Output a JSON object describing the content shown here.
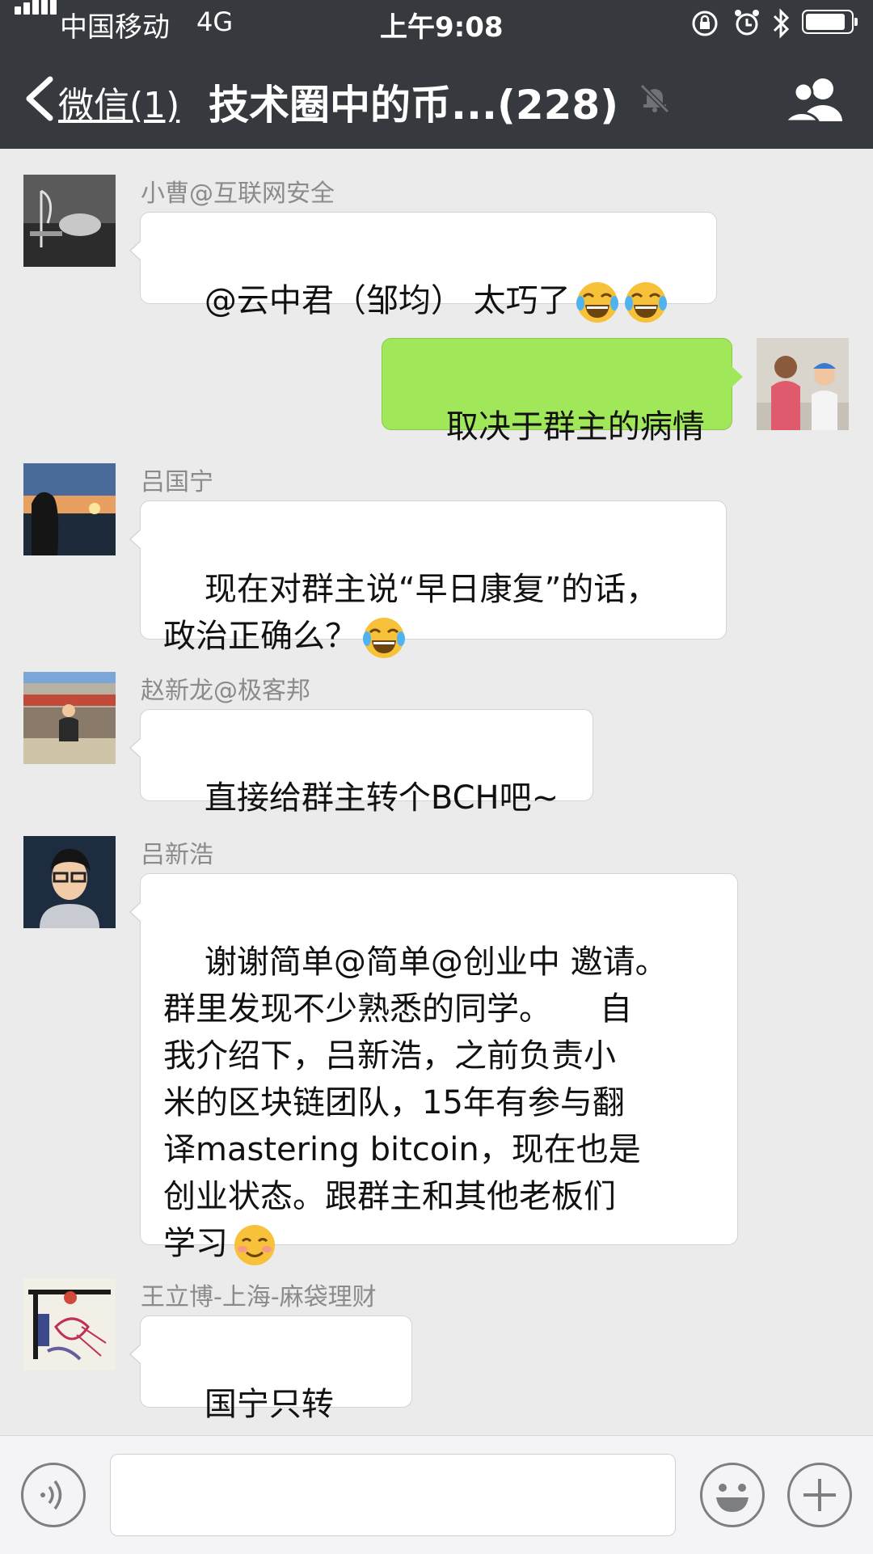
{
  "status_bar": {
    "carrier": "中国移动",
    "network": "4G",
    "time": "上午9:08",
    "icons": [
      "signal-icon",
      "rotation-lock-icon",
      "alarm-icon",
      "bluetooth-icon",
      "battery-icon"
    ]
  },
  "nav": {
    "back_label": "微信(1)",
    "title": "技术圈中的币...(228)",
    "mute_icon": "bell-muted-icon",
    "members_icon": "group-members-icon"
  },
  "messages": [
    {
      "sender": "小曹@互联网安全",
      "text": "@云中君（邹均） 太巧了",
      "emoji": [
        "tears-of-joy",
        "tears-of-joy"
      ],
      "side": "left"
    },
    {
      "sender": "",
      "text": "取决于群主的病情",
      "emoji": [],
      "side": "right"
    },
    {
      "sender": "吕国宁",
      "text": "现在对群主说“早日康复”的话，\n政治正确么？",
      "emoji": [
        "tears-of-joy"
      ],
      "side": "left"
    },
    {
      "sender": "赵新龙@极客邦",
      "text": "直接给群主转个BCH吧~",
      "emoji": [],
      "side": "left"
    },
    {
      "sender": "吕新浩",
      "text": "谢谢简单@简单@创业中 邀请。\n群里发现不少熟悉的同学。　　自\n我介绍下，吕新浩，之前负责小\n米的区块链团队，15年有参与翻\n译mastering bitcoin，现在也是\n创业状态。跟群主和其他老板们\n学习",
      "emoji": [
        "smiling-face"
      ],
      "side": "left"
    },
    {
      "sender": "王立博-上海-麻袋理财",
      "text": "国宁只转ETH",
      "emoji": [],
      "side": "left"
    }
  ],
  "input_bar": {
    "voice_icon": "voice-icon",
    "placeholder": "",
    "emoji_icon": "emoji-icon",
    "plus_icon": "plus-icon"
  },
  "colors": {
    "nav_bg": "#363a3f",
    "chat_bg": "#ebebeb",
    "sent_bubble": "#a0e75a",
    "received_bubble": "#ffffff",
    "sender_name": "#8b8b8b"
  }
}
